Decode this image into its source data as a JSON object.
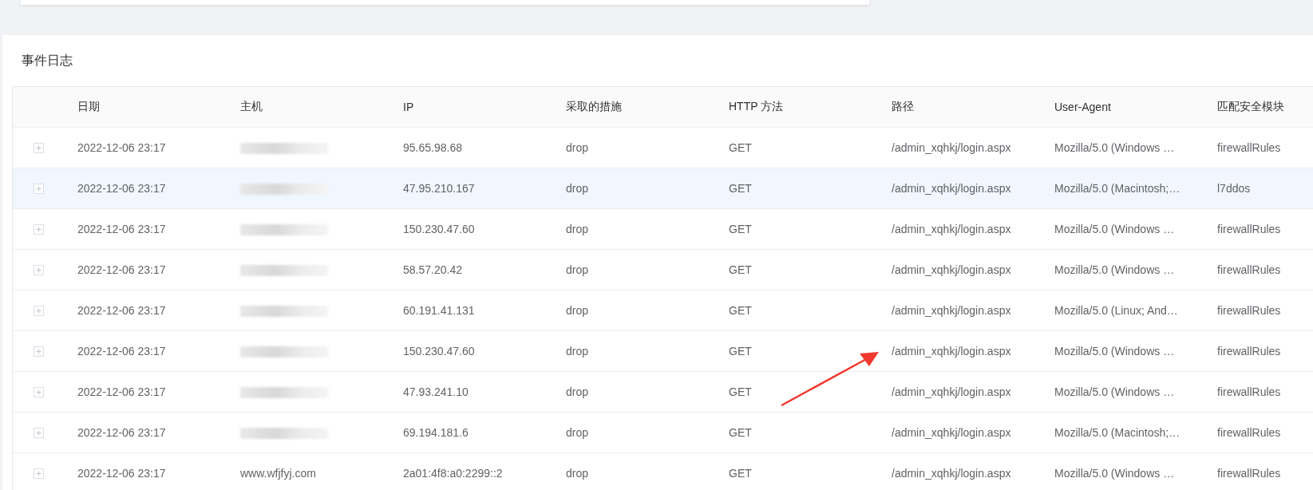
{
  "panel": {
    "title": "事件日志"
  },
  "table": {
    "columns": [
      "日期",
      "主机",
      "IP",
      "采取的措施",
      "HTTP 方法",
      "路径",
      "User-Agent",
      "匹配安全模块"
    ],
    "rows": [
      {
        "date": "2022-12-06 23:17",
        "host_blurred": true,
        "ip": "95.65.98.68",
        "action": "drop",
        "method": "GET",
        "path": "/admin_xqhkj/login.aspx",
        "user_agent": "Mozilla/5.0 (Windows …",
        "module": "firewallRules",
        "highlighted": false
      },
      {
        "date": "2022-12-06 23:17",
        "host_blurred": true,
        "ip": "47.95.210.167",
        "action": "drop",
        "method": "GET",
        "path": "/admin_xqhkj/login.aspx",
        "user_agent": "Mozilla/5.0 (Macintosh;…",
        "module": "l7ddos",
        "highlighted": true
      },
      {
        "date": "2022-12-06 23:17",
        "host_blurred": true,
        "ip": "150.230.47.60",
        "action": "drop",
        "method": "GET",
        "path": "/admin_xqhkj/login.aspx",
        "user_agent": "Mozilla/5.0 (Windows …",
        "module": "firewallRules",
        "highlighted": false
      },
      {
        "date": "2022-12-06 23:17",
        "host_blurred": true,
        "ip": "58.57.20.42",
        "action": "drop",
        "method": "GET",
        "path": "/admin_xqhkj/login.aspx",
        "user_agent": "Mozilla/5.0 (Windows …",
        "module": "firewallRules",
        "highlighted": false
      },
      {
        "date": "2022-12-06 23:17",
        "host_blurred": true,
        "ip": "60.191.41.131",
        "action": "drop",
        "method": "GET",
        "path": "/admin_xqhkj/login.aspx",
        "user_agent": "Mozilla/5.0 (Linux; And…",
        "module": "firewallRules",
        "highlighted": false
      },
      {
        "date": "2022-12-06 23:17",
        "host_blurred": true,
        "ip": "150.230.47.60",
        "action": "drop",
        "method": "GET",
        "path": "/admin_xqhkj/login.aspx",
        "user_agent": "Mozilla/5.0 (Windows …",
        "module": "firewallRules",
        "highlighted": false
      },
      {
        "date": "2022-12-06 23:17",
        "host_blurred": true,
        "ip": "47.93.241.10",
        "action": "drop",
        "method": "GET",
        "path": "/admin_xqhkj/login.aspx",
        "user_agent": "Mozilla/5.0 (Windows …",
        "module": "firewallRules",
        "highlighted": false
      },
      {
        "date": "2022-12-06 23:17",
        "host_blurred": true,
        "ip": "69.194.181.6",
        "action": "drop",
        "method": "GET",
        "path": "/admin_xqhkj/login.aspx",
        "user_agent": "Mozilla/5.0 (Macintosh;…",
        "module": "firewallRules",
        "highlighted": false
      },
      {
        "date": "2022-12-06 23:17",
        "host_blurred": false,
        "host": "www.wfjfyj.com",
        "ip": "2a01:4f8:a0:2299::2",
        "action": "drop",
        "method": "GET",
        "path": "/admin_xqhkj/login.aspx",
        "user_agent": "Mozilla/5.0 (Windows …",
        "module": "firewallRules",
        "highlighted": false
      }
    ]
  }
}
